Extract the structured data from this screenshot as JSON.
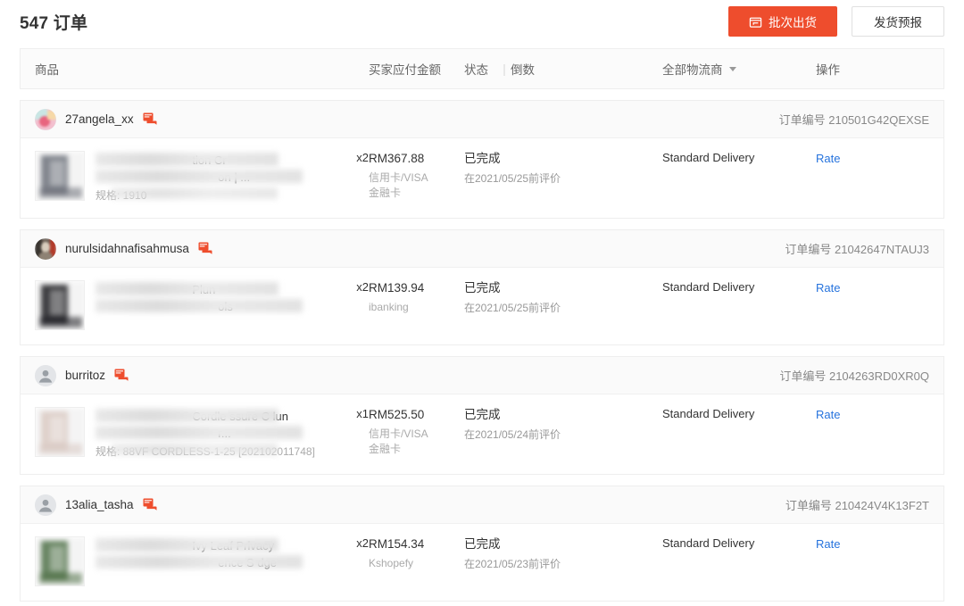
{
  "header": {
    "title": "547 订单",
    "buttons": [
      {
        "label": "批次出货",
        "icon": "box-icon",
        "style": "primary"
      },
      {
        "label": "发货预报",
        "icon": "",
        "style": "secondary"
      }
    ]
  },
  "table_headers": {
    "product": "商品",
    "amount": "买家应付金额",
    "status": "状态",
    "separator": "|",
    "countdown": "倒数",
    "logistics": "全部物流商",
    "logistics_caret": "chevron-down-icon",
    "action": "操作"
  },
  "orders": [
    {
      "buyer": "27angela_xx",
      "avatar_type": "photo-pink",
      "chat_icon": "chat-icon",
      "order_label": "订单编号",
      "order_no": "210501G42QEXSE",
      "product_line1": "tion Cr",
      "product_line2": "on | ...",
      "spec": "规格: 1910",
      "thumb_color": "#6b7079",
      "qty": "x2",
      "amount": "RM367.88",
      "pay_method": "信用卡/VISA金融卡",
      "status": "已完成",
      "status_sub": "在2021/05/25前评价",
      "logistics": "Standard Delivery",
      "action": "Rate"
    },
    {
      "buyer": "nurulsidahnafisahmusa",
      "avatar_type": "photo-dark",
      "chat_icon": "chat-icon",
      "order_label": "订单编号",
      "order_no": "21042647NTAUJ3",
      "product_line1": "Plun",
      "product_line2": "ols",
      "spec": "",
      "thumb_color": "#1c1c20",
      "qty": "x2",
      "amount": "RM139.94",
      "pay_method": "ibanking",
      "status": "已完成",
      "status_sub": "在2021/05/25前评价",
      "logistics": "Standard Delivery",
      "action": "Rate"
    },
    {
      "buyer": "burritoz",
      "avatar_type": "default",
      "chat_icon": "chat-icon",
      "order_label": "订单编号",
      "order_no": "2104263RD0XR0Q",
      "product_line1": "Cordle            ssure C                 lun",
      "product_line2": "r...",
      "spec": "规格: 88VF CORDLESS-1-25 [202102011748]",
      "thumb_color": "#d9c9c2",
      "qty": "x1",
      "amount": "RM525.50",
      "pay_method": "信用卡/VISA金融卡",
      "status": "已完成",
      "status_sub": "在2021/05/24前评价",
      "logistics": "Standard Delivery",
      "action": "Rate"
    },
    {
      "buyer": "13alia_tasha",
      "avatar_type": "default",
      "chat_icon": "chat-icon",
      "order_label": "订单编号",
      "order_no": "210424V4K13F2T",
      "product_line1": "Ivy Leaf Privacy",
      "product_line2": "ence S                    dge",
      "spec": "",
      "thumb_color": "#4e7046",
      "qty": "x2",
      "amount": "RM154.34",
      "pay_method": "Kshopefy",
      "status": "已完成",
      "status_sub": "在2021/05/23前评价",
      "logistics": "Standard Delivery",
      "action": "Rate"
    }
  ],
  "colors": {
    "primary": "#ee4d2d",
    "link": "#2673dd",
    "chat": "#ee4d2d"
  }
}
